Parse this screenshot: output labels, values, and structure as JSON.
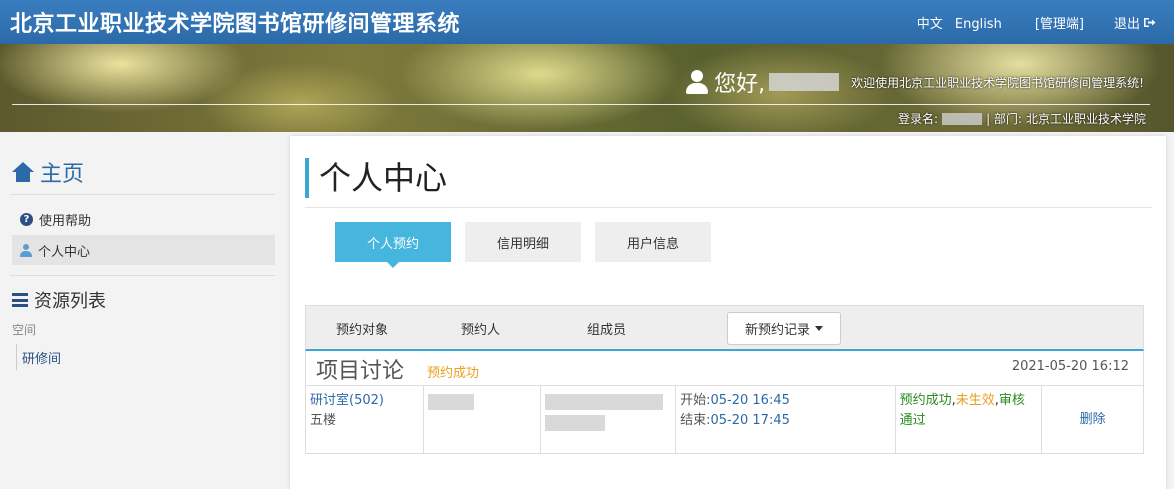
{
  "header": {
    "title": "北京工业职业技术学院图书馆研修间管理系统",
    "lang_zh": "中文",
    "lang_en": "English",
    "admin": "[管理端]",
    "logout": "退出"
  },
  "banner": {
    "hello": "您好,",
    "welcome": "欢迎使用北京工业职业技术学院图书馆研修间管理系统!",
    "login_label": "登录名:",
    "dept_label": "| 部门:",
    "dept_value": "北京工业职业技术学院"
  },
  "sidebar": {
    "home": "主页",
    "help": "使用帮助",
    "personal": "个人中心",
    "resources": "资源列表",
    "space": "空间",
    "room": "研修间"
  },
  "main": {
    "title": "个人中心",
    "tabs": [
      {
        "label": "个人预约"
      },
      {
        "label": "信用明细"
      },
      {
        "label": "用户信息"
      }
    ],
    "columns": [
      "预约对象",
      "预约人",
      "组成员"
    ],
    "new_button": "新预约记录"
  },
  "record": {
    "title": "项目讨论",
    "status": "预约成功",
    "time": "2021-05-20 16:12",
    "room": "研讨室(502)",
    "floor": "五楼",
    "start_label": "开始:",
    "start_time": "05-20 16:45",
    "end_label": "结束:",
    "end_time": "05-20 17:45",
    "state_success": "预约成功",
    "state_sep1": ",",
    "state_pending": "未生效",
    "state_sep2": ",",
    "state_review": "审核通过",
    "delete": "删除"
  },
  "colors": {
    "header_blue": "#2b6aa8",
    "tab_active": "#47b6de",
    "success_green": "#2a8a1f",
    "pending_orange": "#e9a11f"
  }
}
